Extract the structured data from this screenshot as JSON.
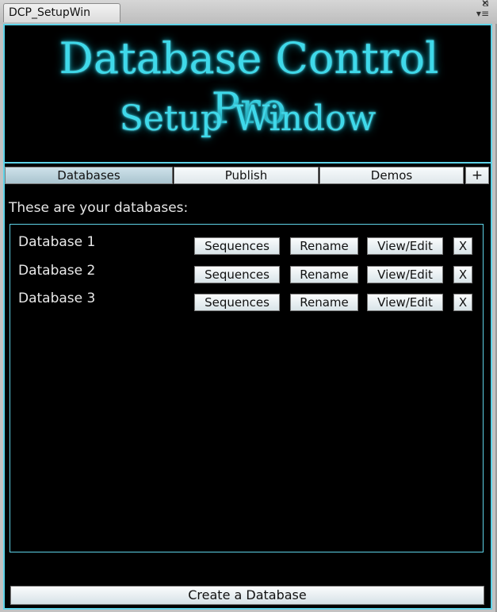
{
  "window": {
    "tab_title": "DCP_SetupWin",
    "controls": [
      "▫",
      "✕",
      "▾≡"
    ]
  },
  "banner": {
    "line1": "Database Control Pro",
    "line2": "Setup Window"
  },
  "tabs": [
    {
      "label": "Databases",
      "active": true
    },
    {
      "label": "Publish",
      "active": false
    },
    {
      "label": "Demos",
      "active": false
    },
    {
      "label": "+",
      "active": false
    }
  ],
  "subtitle": "These are your databases:",
  "databases": [
    {
      "name": "Database 1",
      "sequences_label": "Sequences",
      "rename_label": "Rename",
      "view_label": "View/Edit",
      "delete_label": "X"
    },
    {
      "name": "Database 2",
      "sequences_label": "Sequences",
      "rename_label": "Rename",
      "view_label": "View/Edit",
      "delete_label": "X"
    },
    {
      "name": "Database 3",
      "sequences_label": "Sequences",
      "rename_label": "Rename",
      "view_label": "View/Edit",
      "delete_label": "X"
    }
  ],
  "create_label": "Create a Database",
  "colors": {
    "accent": "#5ed3e8",
    "title_glow": "#3fd9ea",
    "background": "#000000"
  }
}
